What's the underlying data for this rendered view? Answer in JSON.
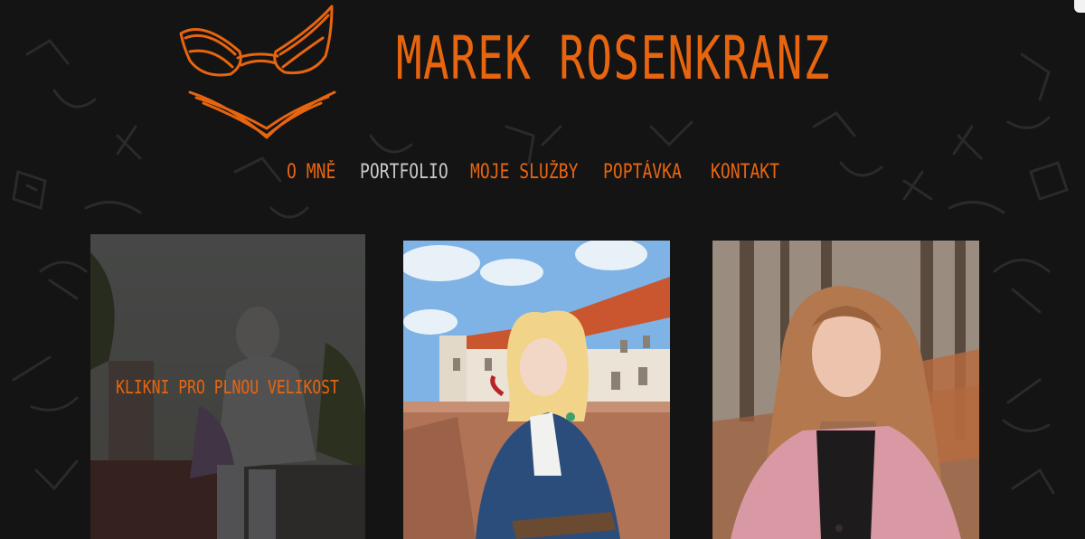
{
  "site": {
    "title": "MAREK ROSENKRANZ",
    "accent_color": "#e8650f",
    "background_color": "#141414"
  },
  "nav": {
    "items": [
      {
        "label": "O MNĚ",
        "active": false
      },
      {
        "label": "PORTFOLIO",
        "active": true
      },
      {
        "label": "MOJE SLUŽBY",
        "active": false
      },
      {
        "label": "POPTÁVKA",
        "active": false
      },
      {
        "label": "KONTAKT",
        "active": false
      }
    ]
  },
  "gallery": {
    "overlay_text": "KLIKNI PRO PLNOU VELIKOST",
    "items": [
      {
        "subject": "white-haired cosplayer on stone wall",
        "hovered": true
      },
      {
        "subject": "blonde cosplayer in blue coat at castle",
        "hovered": false
      },
      {
        "subject": "woman in pink coat in autumn forest",
        "hovered": false
      }
    ]
  }
}
